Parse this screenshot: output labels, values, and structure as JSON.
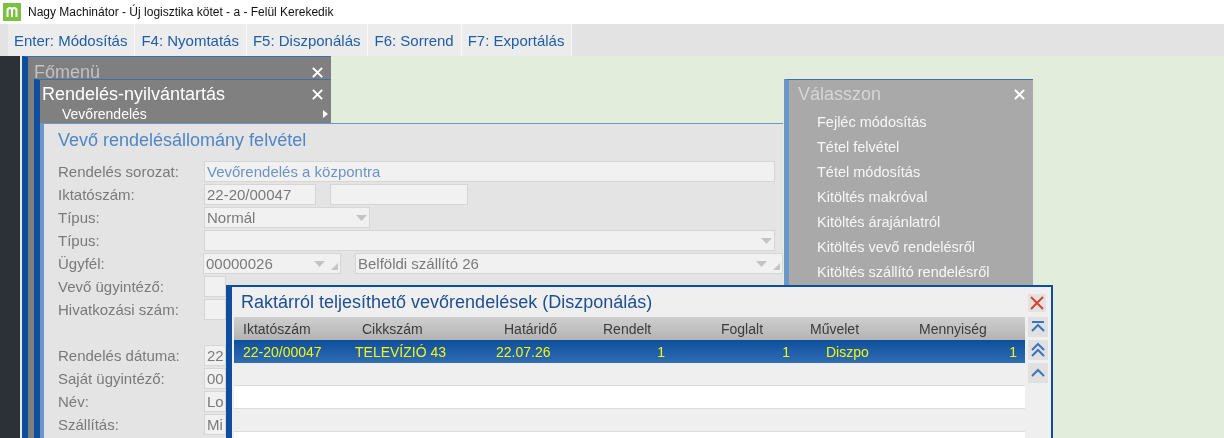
{
  "window": {
    "title": "Nagy Machinátor - Új logisztika kötet - a - Felül Kerekedik"
  },
  "toolbar": [
    {
      "label": "Enter: Módosítás"
    },
    {
      "label": "F4: Nyomtatás"
    },
    {
      "label": "F5: Diszponálás"
    },
    {
      "label": "F6: Sorrend"
    },
    {
      "label": "F7: Exportálás"
    }
  ],
  "main_menu": {
    "title": "Főmenü"
  },
  "order_menu": {
    "title": "Rendelés-nyilvántartás",
    "items": [
      {
        "label": "Vevőrendelés",
        "has_submenu": true
      }
    ]
  },
  "order_form": {
    "title": "Vevő rendelésállomány felvétel",
    "rows": [
      {
        "label": "Rendelés sorozat:",
        "fields": [
          {
            "kind": "text",
            "value": "Vevőrendelés a központra"
          }
        ]
      },
      {
        "label": "Iktatószám:",
        "fields": [
          {
            "kind": "text",
            "value": "22-20/00047"
          },
          {
            "kind": "text"
          }
        ]
      },
      {
        "label": "Típus:",
        "fields": [
          {
            "kind": "dropdown",
            "value": "Normál"
          }
        ]
      },
      {
        "label": "Típus:",
        "fields": [
          {
            "kind": "dropdown"
          }
        ]
      },
      {
        "label": "Ügyfél:",
        "fields": [
          {
            "kind": "lookup",
            "value": "00000026"
          },
          {
            "kind": "lookup",
            "value": "Belföldi szállító 26"
          }
        ]
      },
      {
        "label": "Vevő ügyintéző:",
        "fields": [
          {
            "kind": "text"
          }
        ]
      },
      {
        "label": "Hivatkozási szám:",
        "fields": [
          {
            "kind": "text"
          }
        ]
      },
      {
        "label": "Rendelés dátuma:",
        "fields": [
          {
            "kind": "text",
            "value": "22"
          }
        ]
      },
      {
        "label": "Saját ügyintéző:",
        "fields": [
          {
            "kind": "text",
            "value": "00"
          }
        ]
      },
      {
        "label": "Név:",
        "fields": [
          {
            "kind": "text",
            "value": "Lo"
          }
        ]
      },
      {
        "label": "Szállítás:",
        "fields": [
          {
            "kind": "text",
            "value": "Mi"
          }
        ]
      }
    ]
  },
  "choose_menu": {
    "title": "Válasszon",
    "items": [
      {
        "label": "Fejléc módosítás"
      },
      {
        "label": "Tétel felvétel"
      },
      {
        "label": "Tétel módosítás"
      },
      {
        "label": "Kitöltés makróval"
      },
      {
        "label": "Kitöltés árajánlatról"
      },
      {
        "label": "Kitöltés vevő rendelésről"
      },
      {
        "label": "Kitöltés szállító rendelésről"
      }
    ]
  },
  "dispo": {
    "title": "Raktárról teljesíthető vevőrendelések (Diszponálás)",
    "columns": [
      "Iktatószám",
      "Cikkszám",
      "Határidő",
      "Rendelt",
      "Foglalt",
      "Művelet",
      "Mennyiség"
    ],
    "rows": [
      {
        "selected": true,
        "cells": [
          "22-20/00047",
          "TELEVÍZIÓ 43",
          "22.07.26",
          "1",
          "1",
          "Diszpo",
          "1"
        ]
      }
    ]
  }
}
